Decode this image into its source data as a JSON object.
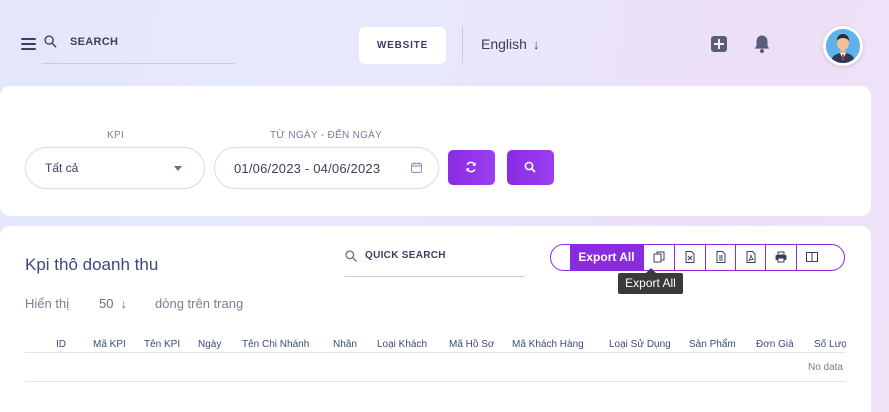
{
  "header": {
    "search_placeholder": "SEARCH",
    "website_label": "WEBSITE",
    "language": "English"
  },
  "filters": {
    "kpi_label": "KPI",
    "kpi_value": "Tất cả",
    "date_label": "TỪ NGÀY - ĐẾN NGÀY",
    "date_value": "01/06/2023 - 04/06/2023"
  },
  "table": {
    "title": "Kpi thô doanh thu",
    "quick_search_placeholder": "QUICK SEARCH",
    "export_all_label": "Export All",
    "tooltip": "Export All",
    "show_label": "Hiển thị",
    "page_size": "50",
    "rows_label": "dòng trên trang",
    "columns": [
      "ID",
      "Mã KPI",
      "Tên KPI",
      "Ngày",
      "Tên Chi Nhánh",
      "Nhân",
      "Loại Khách",
      "Mã Hồ Sơ",
      "Mã Khách Hàng",
      "Loại Sử Dụng",
      "Sản Phẩm",
      "Đơn Giá",
      "Số Lượ"
    ],
    "empty_text": "No data"
  },
  "colors": {
    "accent": "#8a2be2",
    "heading": "#3b4a7a"
  }
}
